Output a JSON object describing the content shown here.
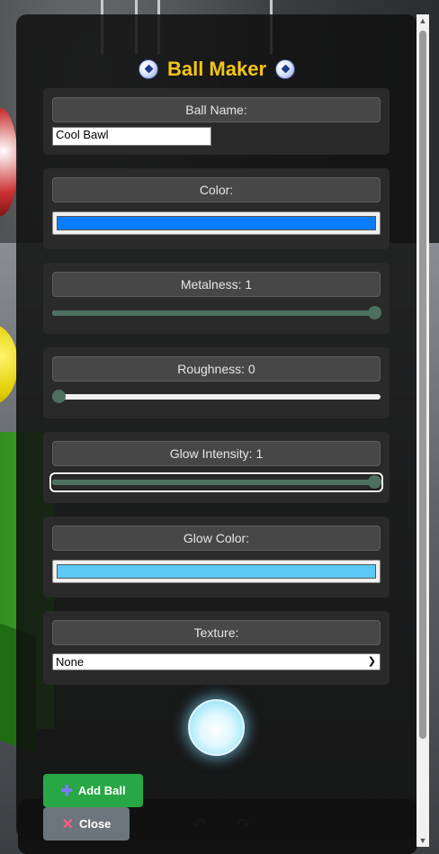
{
  "panel": {
    "title": "Ball Maker"
  },
  "sections": {
    "name": {
      "label": "Ball Name:",
      "value": "Cool Bawl"
    },
    "color": {
      "label": "Color:",
      "value": "#0a7cff"
    },
    "metalness": {
      "label": "Metalness: 1",
      "value": 1
    },
    "roughness": {
      "label": "Roughness: 0",
      "value": 0
    },
    "glow_intensity": {
      "label": "Glow Intensity: 1",
      "value": 1
    },
    "glow_color": {
      "label": "Glow Color:",
      "value": "#5bc8f5"
    },
    "texture": {
      "label": "Texture:",
      "selected": "None"
    }
  },
  "buttons": {
    "add": "Add Ball",
    "close": "Close"
  },
  "colors": {
    "title": "#f5c518",
    "add_button": "#28a745",
    "close_button": "#6c757d",
    "slider_fill": "#4d7060"
  }
}
